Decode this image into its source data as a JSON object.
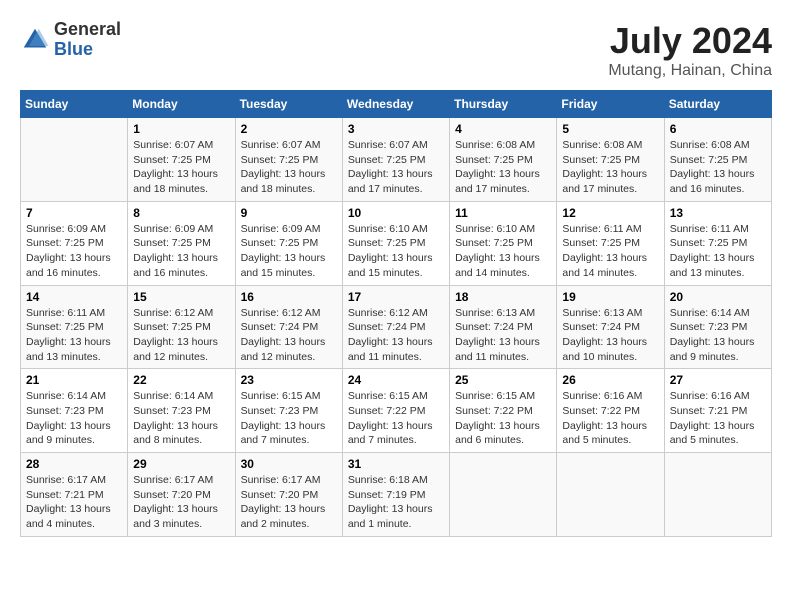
{
  "logo": {
    "general": "General",
    "blue": "Blue"
  },
  "title": "July 2024",
  "location": "Mutang, Hainan, China",
  "days_of_week": [
    "Sunday",
    "Monday",
    "Tuesday",
    "Wednesday",
    "Thursday",
    "Friday",
    "Saturday"
  ],
  "weeks": [
    [
      {
        "day": "",
        "sunrise": "",
        "sunset": "",
        "daylight": ""
      },
      {
        "day": "1",
        "sunrise": "6:07 AM",
        "sunset": "7:25 PM",
        "daylight": "13 hours and 18 minutes."
      },
      {
        "day": "2",
        "sunrise": "6:07 AM",
        "sunset": "7:25 PM",
        "daylight": "13 hours and 18 minutes."
      },
      {
        "day": "3",
        "sunrise": "6:07 AM",
        "sunset": "7:25 PM",
        "daylight": "13 hours and 17 minutes."
      },
      {
        "day": "4",
        "sunrise": "6:08 AM",
        "sunset": "7:25 PM",
        "daylight": "13 hours and 17 minutes."
      },
      {
        "day": "5",
        "sunrise": "6:08 AM",
        "sunset": "7:25 PM",
        "daylight": "13 hours and 17 minutes."
      },
      {
        "day": "6",
        "sunrise": "6:08 AM",
        "sunset": "7:25 PM",
        "daylight": "13 hours and 16 minutes."
      }
    ],
    [
      {
        "day": "7",
        "sunrise": "6:09 AM",
        "sunset": "7:25 PM",
        "daylight": "13 hours and 16 minutes."
      },
      {
        "day": "8",
        "sunrise": "6:09 AM",
        "sunset": "7:25 PM",
        "daylight": "13 hours and 16 minutes."
      },
      {
        "day": "9",
        "sunrise": "6:09 AM",
        "sunset": "7:25 PM",
        "daylight": "13 hours and 15 minutes."
      },
      {
        "day": "10",
        "sunrise": "6:10 AM",
        "sunset": "7:25 PM",
        "daylight": "13 hours and 15 minutes."
      },
      {
        "day": "11",
        "sunrise": "6:10 AM",
        "sunset": "7:25 PM",
        "daylight": "13 hours and 14 minutes."
      },
      {
        "day": "12",
        "sunrise": "6:11 AM",
        "sunset": "7:25 PM",
        "daylight": "13 hours and 14 minutes."
      },
      {
        "day": "13",
        "sunrise": "6:11 AM",
        "sunset": "7:25 PM",
        "daylight": "13 hours and 13 minutes."
      }
    ],
    [
      {
        "day": "14",
        "sunrise": "6:11 AM",
        "sunset": "7:25 PM",
        "daylight": "13 hours and 13 minutes."
      },
      {
        "day": "15",
        "sunrise": "6:12 AM",
        "sunset": "7:25 PM",
        "daylight": "13 hours and 12 minutes."
      },
      {
        "day": "16",
        "sunrise": "6:12 AM",
        "sunset": "7:24 PM",
        "daylight": "13 hours and 12 minutes."
      },
      {
        "day": "17",
        "sunrise": "6:12 AM",
        "sunset": "7:24 PM",
        "daylight": "13 hours and 11 minutes."
      },
      {
        "day": "18",
        "sunrise": "6:13 AM",
        "sunset": "7:24 PM",
        "daylight": "13 hours and 11 minutes."
      },
      {
        "day": "19",
        "sunrise": "6:13 AM",
        "sunset": "7:24 PM",
        "daylight": "13 hours and 10 minutes."
      },
      {
        "day": "20",
        "sunrise": "6:14 AM",
        "sunset": "7:23 PM",
        "daylight": "13 hours and 9 minutes."
      }
    ],
    [
      {
        "day": "21",
        "sunrise": "6:14 AM",
        "sunset": "7:23 PM",
        "daylight": "13 hours and 9 minutes."
      },
      {
        "day": "22",
        "sunrise": "6:14 AM",
        "sunset": "7:23 PM",
        "daylight": "13 hours and 8 minutes."
      },
      {
        "day": "23",
        "sunrise": "6:15 AM",
        "sunset": "7:23 PM",
        "daylight": "13 hours and 7 minutes."
      },
      {
        "day": "24",
        "sunrise": "6:15 AM",
        "sunset": "7:22 PM",
        "daylight": "13 hours and 7 minutes."
      },
      {
        "day": "25",
        "sunrise": "6:15 AM",
        "sunset": "7:22 PM",
        "daylight": "13 hours and 6 minutes."
      },
      {
        "day": "26",
        "sunrise": "6:16 AM",
        "sunset": "7:22 PM",
        "daylight": "13 hours and 5 minutes."
      },
      {
        "day": "27",
        "sunrise": "6:16 AM",
        "sunset": "7:21 PM",
        "daylight": "13 hours and 5 minutes."
      }
    ],
    [
      {
        "day": "28",
        "sunrise": "6:17 AM",
        "sunset": "7:21 PM",
        "daylight": "13 hours and 4 minutes."
      },
      {
        "day": "29",
        "sunrise": "6:17 AM",
        "sunset": "7:20 PM",
        "daylight": "13 hours and 3 minutes."
      },
      {
        "day": "30",
        "sunrise": "6:17 AM",
        "sunset": "7:20 PM",
        "daylight": "13 hours and 2 minutes."
      },
      {
        "day": "31",
        "sunrise": "6:18 AM",
        "sunset": "7:19 PM",
        "daylight": "13 hours and 1 minute."
      },
      {
        "day": "",
        "sunrise": "",
        "sunset": "",
        "daylight": ""
      },
      {
        "day": "",
        "sunrise": "",
        "sunset": "",
        "daylight": ""
      },
      {
        "day": "",
        "sunrise": "",
        "sunset": "",
        "daylight": ""
      }
    ]
  ],
  "labels": {
    "sunrise_prefix": "Sunrise: ",
    "sunset_prefix": "Sunset: ",
    "daylight_prefix": "Daylight: "
  }
}
